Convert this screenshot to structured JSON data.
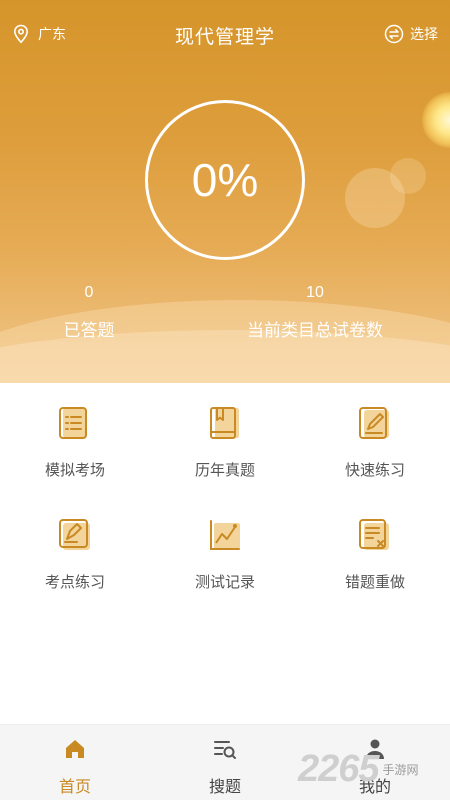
{
  "header": {
    "location": "广东",
    "title": "现代管理学",
    "select_label": "选择"
  },
  "progress": {
    "percent_text": "0%"
  },
  "stats": {
    "answered_value": "0",
    "answered_label": "已答题",
    "total_value": "10",
    "total_label": "当前类目总试卷数"
  },
  "features": [
    {
      "label": "模拟考场",
      "icon": "exam-list-icon"
    },
    {
      "label": "历年真题",
      "icon": "book-icon"
    },
    {
      "label": "快速练习",
      "icon": "edit-pencil-icon"
    },
    {
      "label": "考点练习",
      "icon": "note-pencil-icon"
    },
    {
      "label": "测试记录",
      "icon": "chart-line-icon"
    },
    {
      "label": "错题重做",
      "icon": "wrong-doc-icon"
    }
  ],
  "tabs": [
    {
      "label": "首页",
      "icon": "home-icon",
      "active": true
    },
    {
      "label": "搜题",
      "icon": "search-list-icon",
      "active": false
    },
    {
      "label": "我的",
      "icon": "user-icon",
      "active": false
    }
  ],
  "watermark": {
    "brand": "2265",
    "site": "手游网"
  },
  "colors": {
    "accent": "#c98a23",
    "icon_fill": "#f3d49b",
    "hero_top": "#d6952a",
    "hero_bottom": "#f0c78b"
  }
}
